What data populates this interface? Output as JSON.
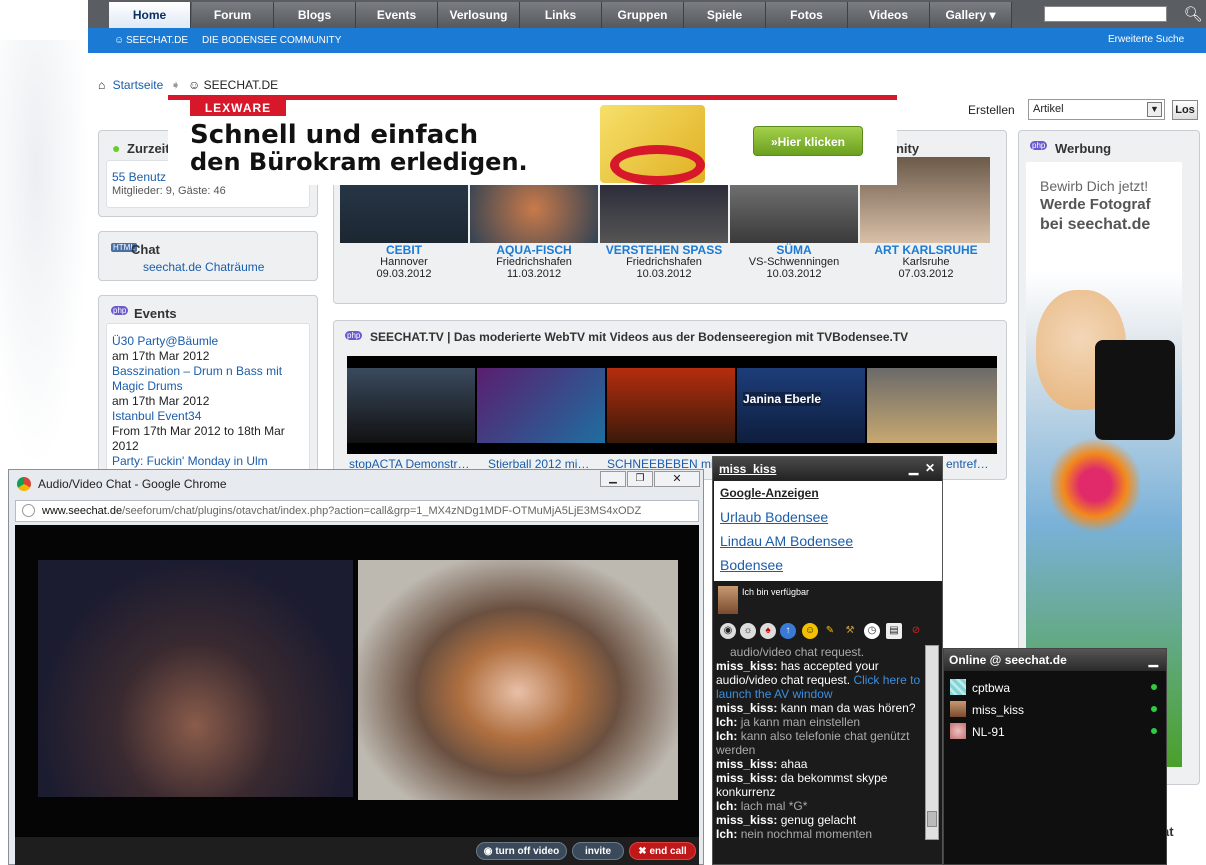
{
  "nav": {
    "items": [
      "Home",
      "Forum",
      "Blogs",
      "Events",
      "Verlosung",
      "Links",
      "Gruppen",
      "Spiele",
      "Fotos",
      "Videos",
      "Gallery"
    ],
    "search_icon": "search-icon"
  },
  "subnav": {
    "site": "SEECHAT.DE",
    "slogan": "DIE BODENSEE COMMUNITY",
    "advanced": "Erweiterte Suche"
  },
  "breadcrumb": {
    "home": "Startseite",
    "current": "SEECHAT.DE"
  },
  "create": {
    "label": "Erstellen",
    "select_value": "Artikel",
    "button": "Los"
  },
  "ad": {
    "brand": "LEXWARE",
    "line1": "Schnell und einfach",
    "line2": "den Bürokram erledigen.",
    "button": "»Hier klicken"
  },
  "sidebar": {
    "zurzeit": {
      "title": "Zurzeit",
      "link": "55 Benutz",
      "stats": "Mitglieder: 9, Gäste: 46"
    },
    "chat": {
      "title": "Chat",
      "link": "seechat.de Chaträume"
    },
    "events": {
      "title": "Events",
      "items": [
        {
          "name": "Ü30 Party@Bäumle",
          "date": "am 17th Mar 2012"
        },
        {
          "name": "Basszination – Drum n Bass mit Magic Drums",
          "date": "am 17th Mar 2012"
        },
        {
          "name": "Istanbul Event34",
          "date": "From 17th Mar 2012 to 18th Mar 2012"
        },
        {
          "name": "Party: Fuckin' Monday in Ulm",
          "date": ""
        }
      ]
    }
  },
  "community_title_fragment": "unity",
  "events_gallery": [
    {
      "title": "CEBIT",
      "place": "Hannover",
      "date": "09.03.2012"
    },
    {
      "title": "AQUA-FISCH",
      "place": "Friedrichshafen",
      "date": "11.03.2012"
    },
    {
      "title": "VERSTEHEN SPASS",
      "place": "Friedrichshafen",
      "date": "10.03.2012"
    },
    {
      "title": "SÜMA",
      "place": "VS-Schwenningen",
      "date": "10.03.2012"
    },
    {
      "title": "ART KARLSRUHE",
      "place": "Karlsruhe",
      "date": "07.03.2012"
    }
  ],
  "tv": {
    "title": "SEECHAT.TV | Das moderierte WebTV mit Videos aus der Bodenseeregion mit TVBodensee.TV",
    "captions": [
      "stopACTA Demonstr…",
      "Stierball 2012 mi…",
      "SCHNEEBEBEN mit",
      "",
      "entref…"
    ],
    "overlay_text": "Janina Eberle"
  },
  "werbung": {
    "title": "Werbung",
    "line1": "Bewirb Dich jetzt!",
    "line2": "Werde Fotograf",
    "line3": "bei seechat.de"
  },
  "chrome_window": {
    "title": "Audio/Video Chat - Google Chrome",
    "url_domain": "www.seechat.de",
    "url_path": "/seeforum/chat/plugins/otavchat/index.php?action=call&grp=1_MX4zNDg1MDF-OTMuMjA5LjE3MS4xODZ",
    "buttons": {
      "video": "turn off video",
      "invite": "invite",
      "end": "end call"
    }
  },
  "chat_window": {
    "user": "miss_kiss",
    "ads_header": "Google-Anzeigen",
    "ads": [
      "Urlaub Bodensee",
      "Lindau AM Bodensee",
      "Bodensee"
    ],
    "status": "Ich bin verfügbar",
    "messages": [
      {
        "who": "",
        "text": "audio/video chat request.",
        "style": "me"
      },
      {
        "who": "miss_kiss:",
        "text": "has accepted your audio/video chat request.",
        "link": "Click here to launch the AV window"
      },
      {
        "who": "miss_kiss:",
        "text": "kann man da was hören?"
      },
      {
        "who": "Ich:",
        "text": "ja kann man einstellen",
        "style": "me"
      },
      {
        "who": "Ich:",
        "text": "kann also telefonie chat genützt werden",
        "style": "me"
      },
      {
        "who": "miss_kiss:",
        "text": "ahaa"
      },
      {
        "who": "miss_kiss:",
        "text": "da bekommst skype konkurrenz"
      },
      {
        "who": "Ich:",
        "text": "lach mal *G*",
        "style": "me"
      },
      {
        "who": "miss_kiss:",
        "text": "genug gelacht"
      },
      {
        "who": "Ich:",
        "text": "nein nochmal momenten",
        "style": "me"
      }
    ]
  },
  "online": {
    "title": "Online @ seechat.de",
    "users": [
      "cptbwa",
      "miss_kiss",
      "NL-91"
    ]
  },
  "bottom_right_fragment": "at",
  "colors": {
    "nav_bg": "#5a5e62",
    "subnav": "#1a7ad4",
    "link": "#1a5dab",
    "ad_red": "#d6182a"
  }
}
